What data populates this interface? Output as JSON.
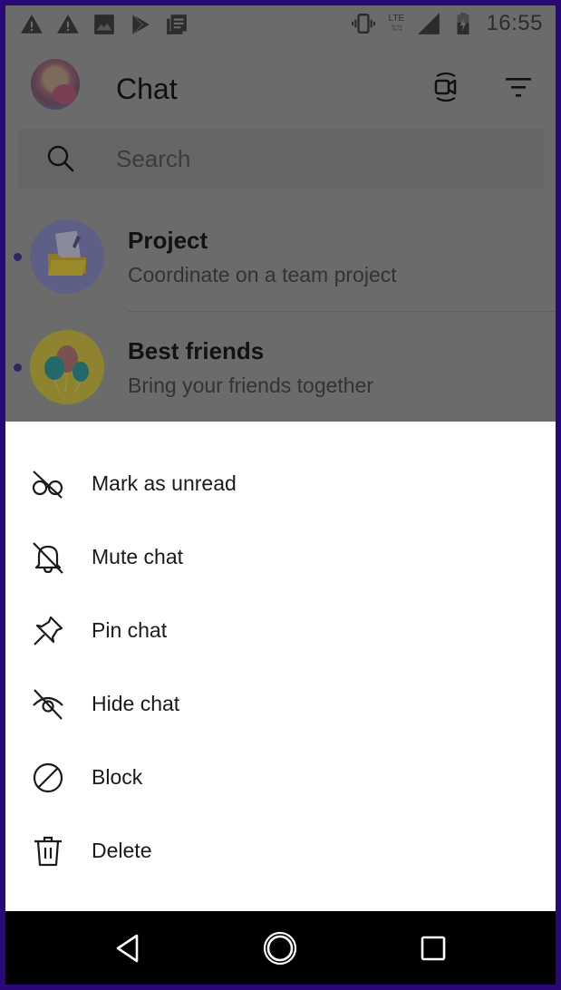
{
  "status_bar": {
    "time": "16:55",
    "network_type": "LTE",
    "left_icons": [
      "warning-icon",
      "warning-icon",
      "image-icon",
      "play-store-icon",
      "news-icon"
    ],
    "right_icons": [
      "vibrate-icon",
      "lte-icon",
      "signal-icon",
      "battery-charging-icon"
    ]
  },
  "header": {
    "title": "Chat",
    "avatar_alt": "Profile picture",
    "actions": [
      "video-call-icon",
      "filter-icon"
    ]
  },
  "search": {
    "placeholder": "Search",
    "value": ""
  },
  "chats": [
    {
      "name": "Project",
      "subtitle": "Coordinate on a team project",
      "unread": true,
      "avatar_icon": "folder-document-icon"
    },
    {
      "name": "Best friends",
      "subtitle": "Bring your friends together",
      "unread": true,
      "avatar_icon": "balloons-icon"
    }
  ],
  "action_sheet": {
    "items": [
      {
        "label": "Mark as unread",
        "icon": "glasses-off-icon"
      },
      {
        "label": "Mute chat",
        "icon": "bell-off-icon"
      },
      {
        "label": "Pin chat",
        "icon": "pin-icon"
      },
      {
        "label": "Hide chat",
        "icon": "eye-off-icon"
      },
      {
        "label": "Block",
        "icon": "block-icon"
      },
      {
        "label": "Delete",
        "icon": "trash-icon"
      }
    ]
  },
  "nav_bar": {
    "buttons": [
      "back-icon",
      "home-icon",
      "recent-apps-icon"
    ]
  },
  "colors": {
    "frame_border": "#2a0878",
    "scrim": "#6b6b6b",
    "sheet_background": "#ffffff",
    "nav_background": "#000000",
    "unread_dot": "#2a2a60"
  }
}
